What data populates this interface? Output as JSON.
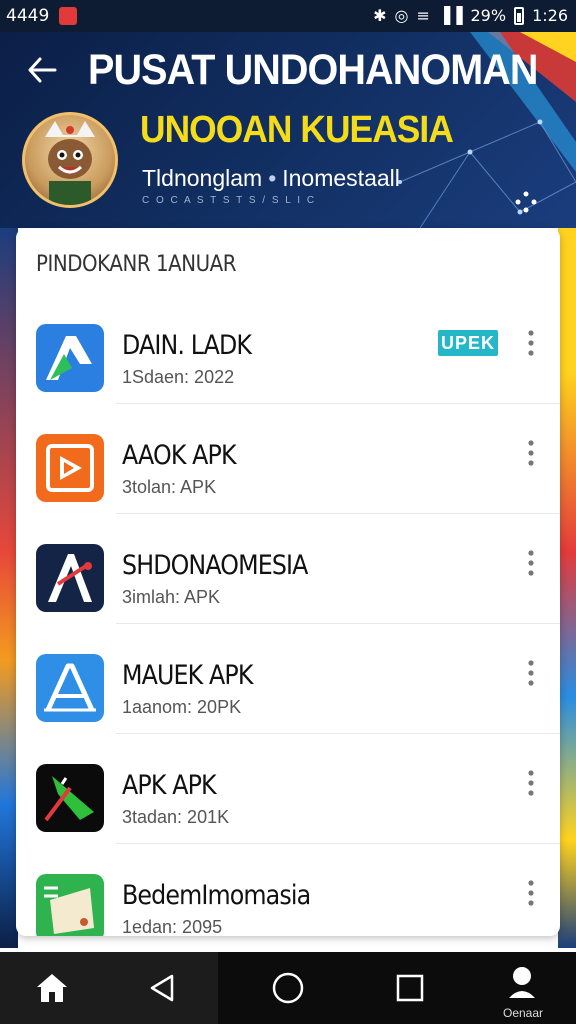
{
  "status_bar": {
    "time_left": "4449",
    "battery_percent": "29%",
    "clock": "1:26"
  },
  "header": {
    "title": "PUSAT UNDOHANOMAN",
    "subtitle": "UNOOAN KUEASIA",
    "tagline_left": "Tldnonglam",
    "tagline_sep": "•",
    "tagline_right": "Inomestaall",
    "caption_small": "C O C A S T S T S / S  L I C"
  },
  "section": {
    "title": "PINDOKANR 1ANUAR"
  },
  "apps": [
    {
      "name": "DAIN. LADK",
      "meta": "1Sdaen: 2022",
      "icon": "blue-arrow-app-icon",
      "badge": "UPEK"
    },
    {
      "name": "AAOK APK",
      "meta": "3tolan: APK",
      "icon": "orange-play-app-icon"
    },
    {
      "name": "SHDONAOMESIA",
      "meta": "3imlah: APK",
      "icon": "navy-a-app-icon"
    },
    {
      "name": "MAUEK APK",
      "meta": "1aanom: 20PK",
      "icon": "blue-a-app-icon"
    },
    {
      "name": "APK APK",
      "meta": "3tadan: 201K",
      "icon": "black-green-app-icon"
    },
    {
      "name": "BedemImomasia",
      "meta": "1edan: 2095",
      "icon": "green-scroll-app-icon"
    }
  ],
  "nav": {
    "profile_label": "Oenaar"
  },
  "colors": {
    "header_bg": "#123064",
    "title": "#ffffff",
    "subtitle": "#f5dc1b",
    "badge": "#25b6c8"
  }
}
